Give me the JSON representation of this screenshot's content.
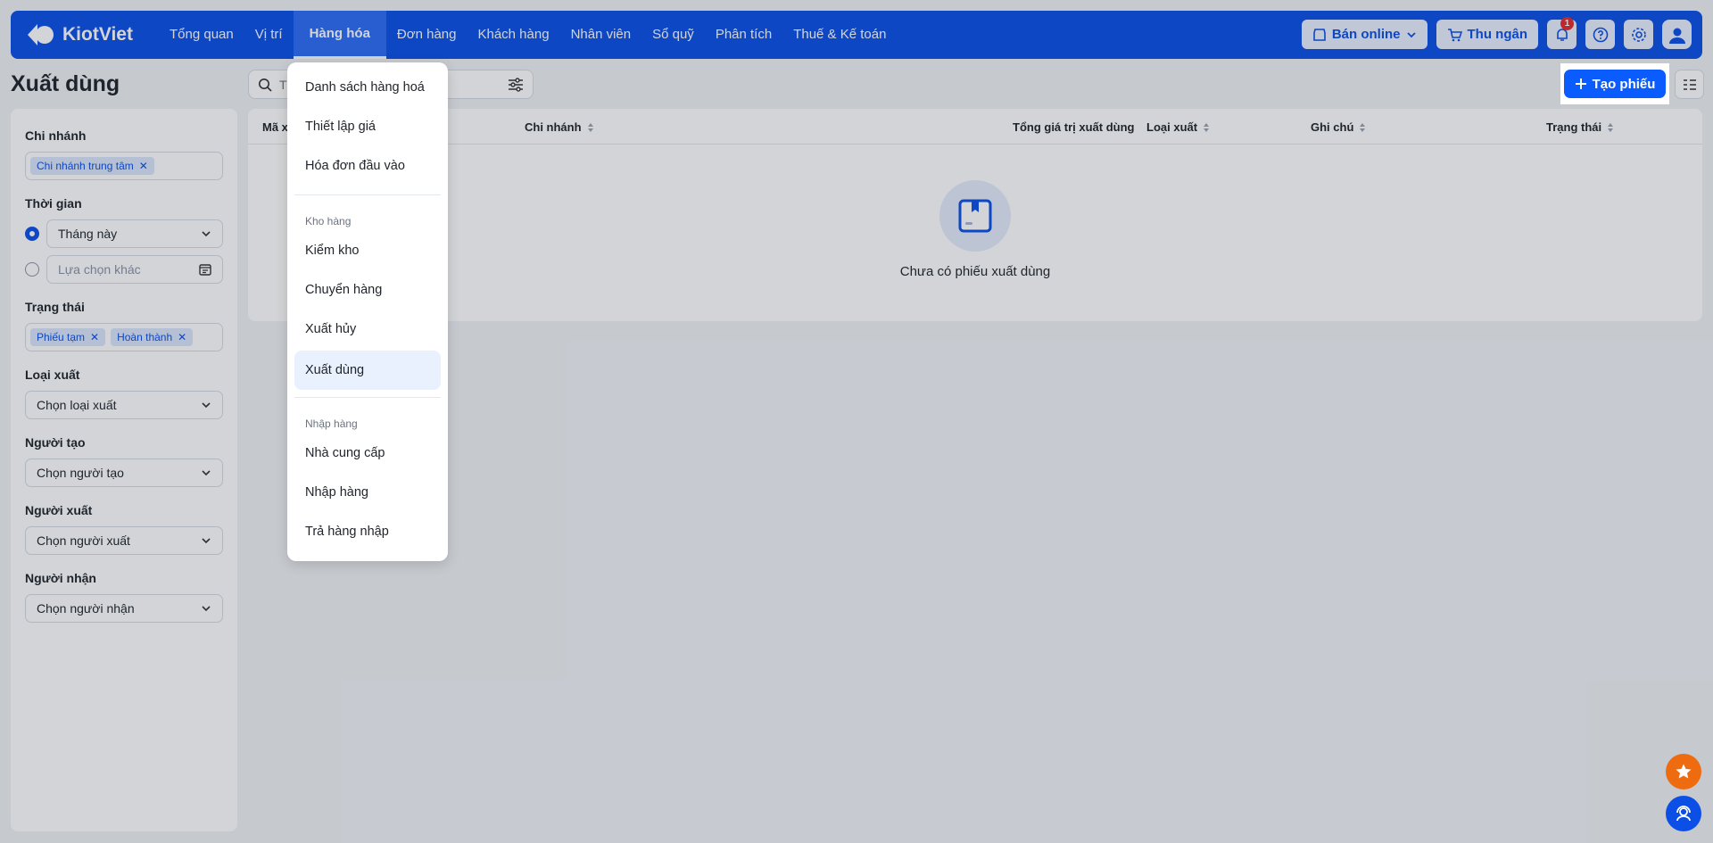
{
  "brand": {
    "name": "KiotViet"
  },
  "nav": [
    "Tổng quan",
    "Vị trí",
    "Hàng hóa",
    "Đơn hàng",
    "Khách hàng",
    "Nhân viên",
    "Sổ quỹ",
    "Phân tích",
    "Thuế & Kế toán"
  ],
  "topbar": {
    "online_label": "Bán online",
    "cashier_label": "Thu ngân",
    "notif_count": "1"
  },
  "page": {
    "title": "Xuất dùng",
    "create_label": "Tạo phiếu",
    "search_placeholder": "T"
  },
  "filters": {
    "branch_label": "Chi nhánh",
    "branch_tags": [
      "Chi nhánh trung tâm"
    ],
    "time_label": "Thời gian",
    "time_selected": "Tháng này",
    "time_other_placeholder": "Lựa chọn khác",
    "status_label": "Trạng thái",
    "status_tags": [
      "Phiếu tạm",
      "Hoàn thành"
    ],
    "type_label": "Loại xuất",
    "type_placeholder": "Chọn loại xuất",
    "creator_label": "Người tạo",
    "creator_placeholder": "Chọn người tạo",
    "exporter_label": "Người xuất",
    "exporter_placeholder": "Chọn người xuất",
    "receiver_label": "Người nhận",
    "receiver_placeholder": "Chọn người nhận"
  },
  "table": {
    "columns": [
      "Mã x",
      "Chi nhánh",
      "Tổng giá trị xuất dùng",
      "Loại xuất",
      "Ghi chú",
      "Trạng thái"
    ],
    "empty_text": "Chưa có phiếu xuất dùng"
  },
  "dropdown": {
    "group1": [
      "Danh sách hàng hoá",
      "Thiết lập giá",
      "Hóa đơn đầu vào"
    ],
    "warehouse_header": "Kho hàng",
    "group2": [
      "Kiểm kho",
      "Chuyển hàng",
      "Xuất hủy",
      "Xuất dùng"
    ],
    "import_header": "Nhập hàng",
    "group3": [
      "Nhà cung cấp",
      "Nhập hàng",
      "Trả hàng nhập"
    ]
  },
  "colors": {
    "primary": "#0b4fe6",
    "accent": "#0b5cff",
    "fab_orange": "#ee6b10"
  }
}
